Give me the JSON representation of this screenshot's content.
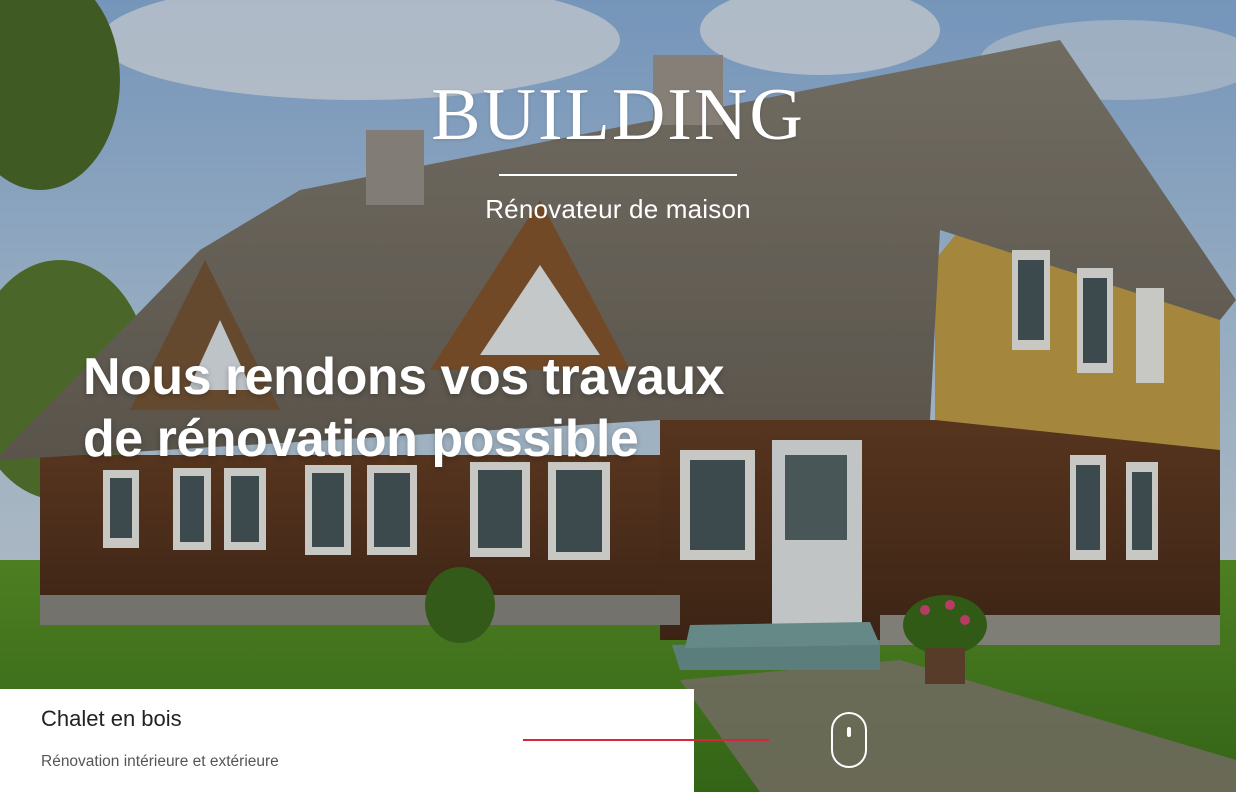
{
  "brand": {
    "title": "BUILDING",
    "subtitle": "Rénovateur de maison"
  },
  "hero": {
    "headline_line1": "Nous rendons vos travaux",
    "headline_line2": "de rénovation possible"
  },
  "slide_caption": {
    "title": "Chalet en bois",
    "subtitle": "Rénovation intérieure et extérieure"
  },
  "icons": {
    "scroll": "scroll-mouse-icon"
  },
  "colors": {
    "accent": "#d6263a",
    "text_light": "#ffffff",
    "card_bg": "#ffffff"
  }
}
